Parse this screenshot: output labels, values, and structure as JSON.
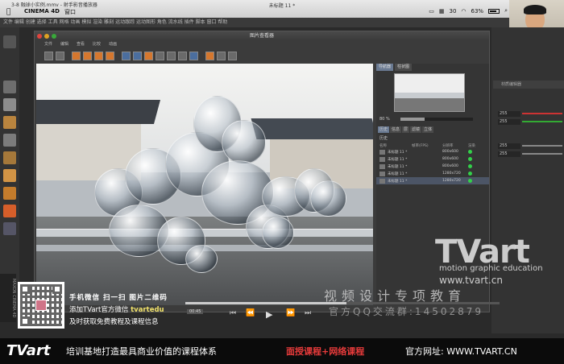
{
  "macbar": {
    "top_title": "3-8 融球小实例.mmv - 射手影音播放器",
    "app_name": "CINEMA 4D",
    "menu": "窗口",
    "doc_title": "未标题 11 *",
    "battery": "63%",
    "num": "30"
  },
  "c4d_menu": "文件  编辑  创建  选择  工具  网格  动画  模拟  渲染  雕刻  运动跟踪  运动图形  角色  流水线  插件  脚本  窗口  帮助",
  "viewer": {
    "title": "图片查看器",
    "menu": [
      "文件",
      "编辑",
      "查看",
      "比较",
      "动画"
    ],
    "tabs": [
      "导航器",
      "柱状图"
    ],
    "zoom": "80 %",
    "info_tabs": [
      "历史",
      "信息",
      "层",
      "滤镜",
      "立体"
    ],
    "history_label": "历史",
    "columns": [
      "名称",
      "帧率(FPS)",
      "分辨率",
      "渲染"
    ],
    "rows": [
      {
        "name": "未标题 11 *",
        "res": "800x600",
        "sel": false
      },
      {
        "name": "未标题 11 *",
        "res": "800x600",
        "sel": false
      },
      {
        "name": "未标题 11 *",
        "res": "800x600",
        "sel": false
      },
      {
        "name": "未标题 11 *",
        "res": "1280x720",
        "sel": false
      },
      {
        "name": "未标题 11 *",
        "res": "1280x720",
        "sel": true
      }
    ]
  },
  "attr": {
    "header": "材质编辑器",
    "values": [
      "255",
      "255",
      "255",
      "255"
    ]
  },
  "watermark": {
    "logo": "TVart",
    "sub": "motion graphic education",
    "url": "www.tvart.cn",
    "cn1": "视频设计专项教育",
    "cn2": "官方QQ交流群:14502879"
  },
  "player": {
    "timecode": "00:45"
  },
  "promo": {
    "line1": "手机微信   扫一扫   图片二维码",
    "line2_prefix": "添加TVart官方微信",
    "line2_highlight": "tvartedu",
    "line3": "及时获取免费教程及课程信息"
  },
  "footer": {
    "logo": "TVart",
    "text1": "培训基地打造最具商业价值的课程体系",
    "text2": "面授课程+网络课程",
    "text3": "官方网址: WWW.TVART.CN"
  },
  "side": "MAXON CINEMA 4D",
  "colors": {
    "accent_orange": "#d5772e",
    "accent_blue": "#4b6e9e",
    "status_green": "#33d04a",
    "footer_red": "#e83b3b",
    "highlight_yellow": "#f0e16a"
  }
}
